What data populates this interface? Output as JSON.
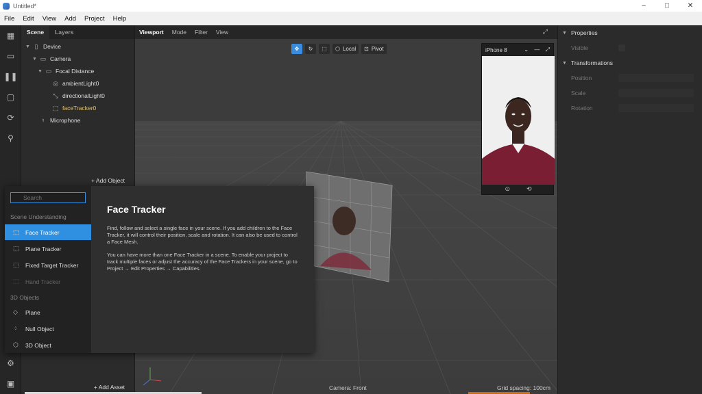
{
  "window": {
    "title": "Untitled*",
    "controls": [
      "–",
      "□",
      "✕"
    ]
  },
  "menu": [
    "File",
    "Edit",
    "View",
    "Add",
    "Project",
    "Help"
  ],
  "left_toolbar": [
    "scene-icon",
    "video-icon",
    "layers-icon",
    "square-icon",
    "refresh-icon",
    "search-icon"
  ],
  "scene_panel": {
    "tabs": [
      "Scene",
      "Layers"
    ],
    "tree": [
      {
        "label": "Device",
        "depth": 0,
        "expanded": true,
        "icon": "device-icon"
      },
      {
        "label": "Camera",
        "depth": 1,
        "expanded": true,
        "icon": "camera-icon"
      },
      {
        "label": "Focal Distance",
        "depth": 2,
        "expanded": true,
        "icon": "focal-distance-icon"
      },
      {
        "label": "ambientLight0",
        "depth": 3,
        "icon": "ambient-light-icon"
      },
      {
        "label": "directionalLight0",
        "depth": 3,
        "icon": "directional-light-icon"
      },
      {
        "label": "faceTracker0",
        "depth": 3,
        "icon": "face-tracker-icon",
        "selected": true
      },
      {
        "label": "Microphone",
        "depth": 0,
        "icon": "microphone-icon"
      }
    ],
    "add_object": "+ Add Object"
  },
  "assets": {
    "add_asset": "+ Add Asset"
  },
  "viewport": {
    "tabs": [
      "Viewport",
      "Mode",
      "Filter",
      "View"
    ],
    "gizmo": {
      "local": "Local",
      "pivot": "Pivot"
    },
    "device": "iPhone 8",
    "camera_status": "Camera: Front",
    "grid_status": "Grid spacing: 100cm"
  },
  "properties": {
    "title": "Properties",
    "visible_label": "Visible",
    "transformations": "Transformations",
    "position": "Position",
    "scale": "Scale",
    "rotation": "Rotation"
  },
  "popup": {
    "search_placeholder": "Search",
    "categories": {
      "scene": "Scene Understanding",
      "objects": "3D Objects"
    },
    "scene_items": [
      {
        "label": "Face Tracker",
        "active": true
      },
      {
        "label": "Plane Tracker"
      },
      {
        "label": "Fixed Target Tracker"
      },
      {
        "label": "Hand Tracker",
        "disabled": true
      }
    ],
    "object_items": [
      {
        "label": "Plane"
      },
      {
        "label": "Null Object"
      },
      {
        "label": "3D Object"
      }
    ],
    "detail": {
      "title": "Face Tracker",
      "p1": "Find, follow and select a single face in your scene. If you add children to the Face Tracker, it will control their position, scale and rotation. It can also be used to control a Face Mesh.",
      "p2": "You can have more than one Face Tracker in a scene. To enable your project to track multiple faces or adjust the accuracy of the Face Trackers in your scene, go to Project → Edit Properties → Capabilities."
    }
  }
}
